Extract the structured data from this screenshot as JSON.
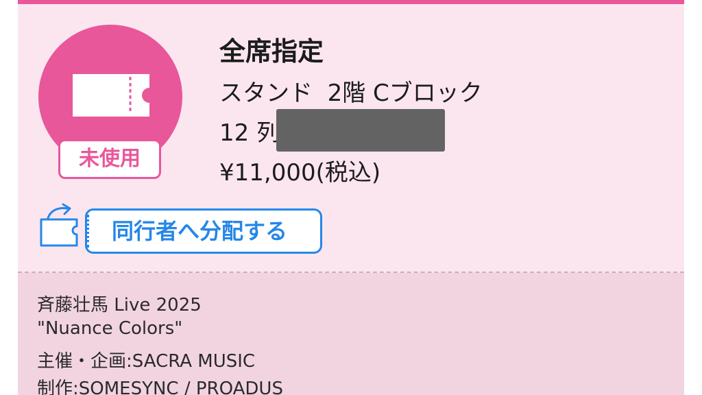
{
  "ticket": {
    "status_badge": "未使用",
    "seat_type": "全席指定",
    "seat_area": "スタンド  2階 Cブロック",
    "seat_row": "12 列",
    "price": "¥11,000(税込)"
  },
  "actions": {
    "distribute_label": "同行者へ分配する"
  },
  "event": {
    "title": "斉藤壮馬 Live 2025",
    "subtitle": "\"Nuance Colors\"",
    "organizer": "主催・企画:SACRA MUSIC",
    "production": "制作:SOMESYNC / PROADUS"
  },
  "colors": {
    "accent_pink": "#e8579a",
    "card_background": "#fbe6ef",
    "footer_background": "#f2d4e1",
    "action_blue": "#2487e8",
    "redaction_gray": "#636363"
  },
  "icons": {
    "ticket": "ticket-icon",
    "share": "share-ticket-icon"
  }
}
